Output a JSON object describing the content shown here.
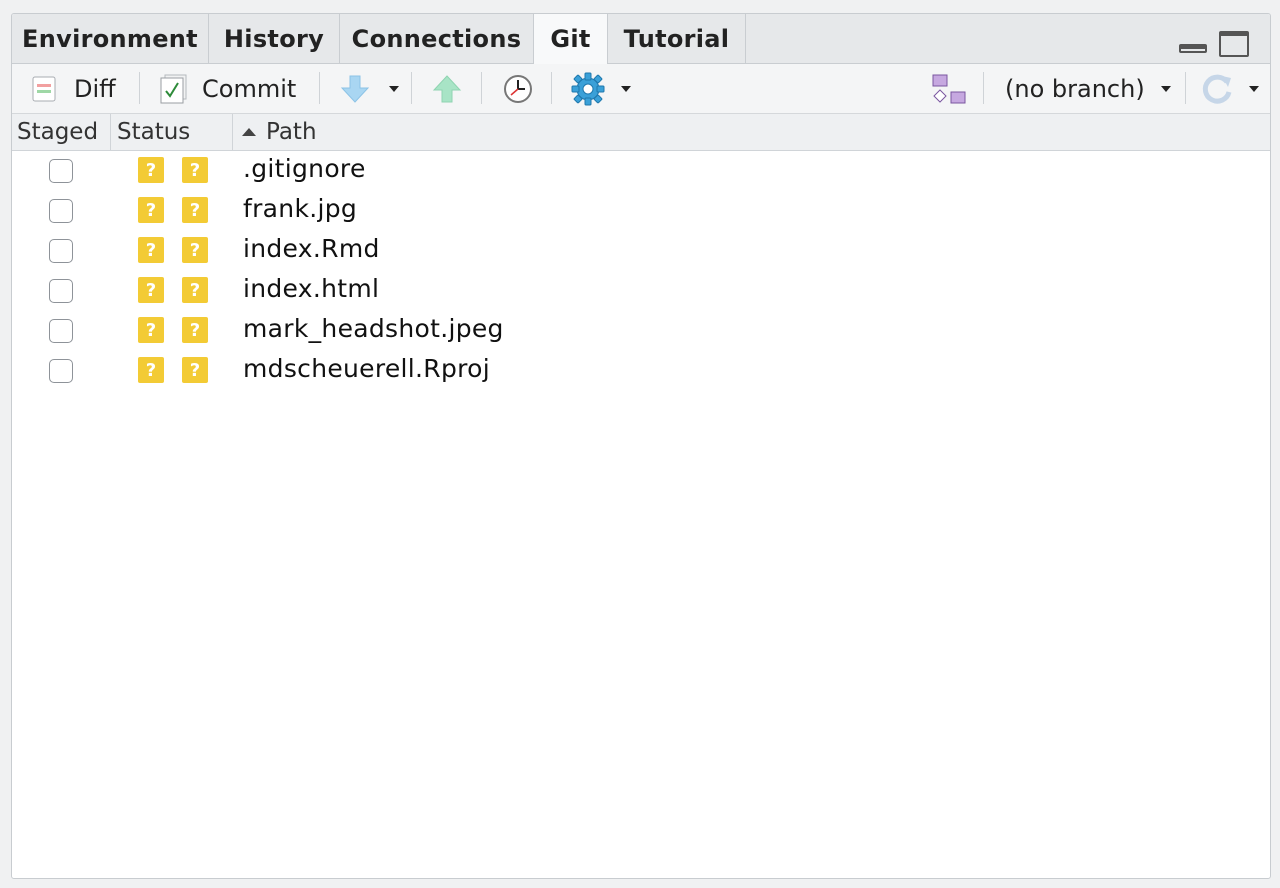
{
  "tabs": [
    {
      "label": "Environment"
    },
    {
      "label": "History"
    },
    {
      "label": "Connections"
    },
    {
      "label": "Git",
      "active": true
    },
    {
      "label": "Tutorial"
    }
  ],
  "toolbar": {
    "diff_label": "Diff",
    "commit_label": "Commit",
    "branch_label": "(no branch)"
  },
  "columns": {
    "staged": "Staged",
    "status": "Status",
    "path": "Path"
  },
  "files": [
    {
      "staged": false,
      "status": [
        "?",
        "?"
      ],
      "path": ".gitignore"
    },
    {
      "staged": false,
      "status": [
        "?",
        "?"
      ],
      "path": "frank.jpg"
    },
    {
      "staged": false,
      "status": [
        "?",
        "?"
      ],
      "path": "index.Rmd"
    },
    {
      "staged": false,
      "status": [
        "?",
        "?"
      ],
      "path": "index.html"
    },
    {
      "staged": false,
      "status": [
        "?",
        "?"
      ],
      "path": "mark_headshot.jpeg"
    },
    {
      "staged": false,
      "status": [
        "?",
        "?"
      ],
      "path": "mdscheuerell.Rproj"
    }
  ],
  "colors": {
    "status_untracked": "#f3cb35",
    "pull_arrow": "#a9d6f2",
    "push_arrow": "#a8e4c6",
    "gear": "#3aa0d8"
  }
}
